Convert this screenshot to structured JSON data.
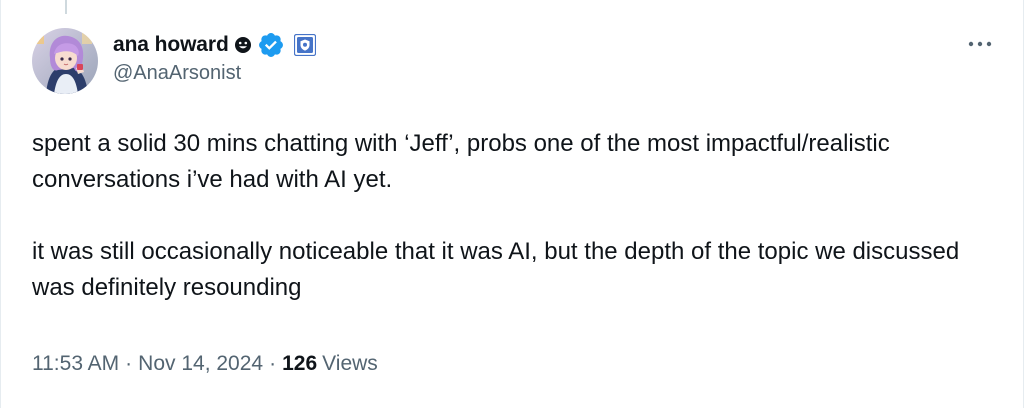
{
  "tweet": {
    "author": {
      "display_name": "ana howard",
      "handle": "@AnaArsonist",
      "avatar_icon": "avatar-anime-girl",
      "badges": [
        "smiley-emoji-icon",
        "verified-badge-icon",
        "affiliate-badge-icon"
      ]
    },
    "text": {
      "paragraph_1": "spent a solid 30 mins chatting with ‘Jeff’, probs one of the most impactful/realistic conversations i’ve had with AI yet.",
      "paragraph_2": "it was still occasionally noticeable that it was AI, but the depth of the topic we discussed was definitely resounding"
    },
    "meta": {
      "time": "11:53 AM",
      "separator": "·",
      "date": "Nov 14, 2024",
      "views_count": "126",
      "views_label": "Views"
    }
  },
  "colors": {
    "verified_blue": "#1d9bf0",
    "affiliate_blue": "#4674c8",
    "secondary_text": "#536471",
    "primary_text": "#0f1419"
  }
}
